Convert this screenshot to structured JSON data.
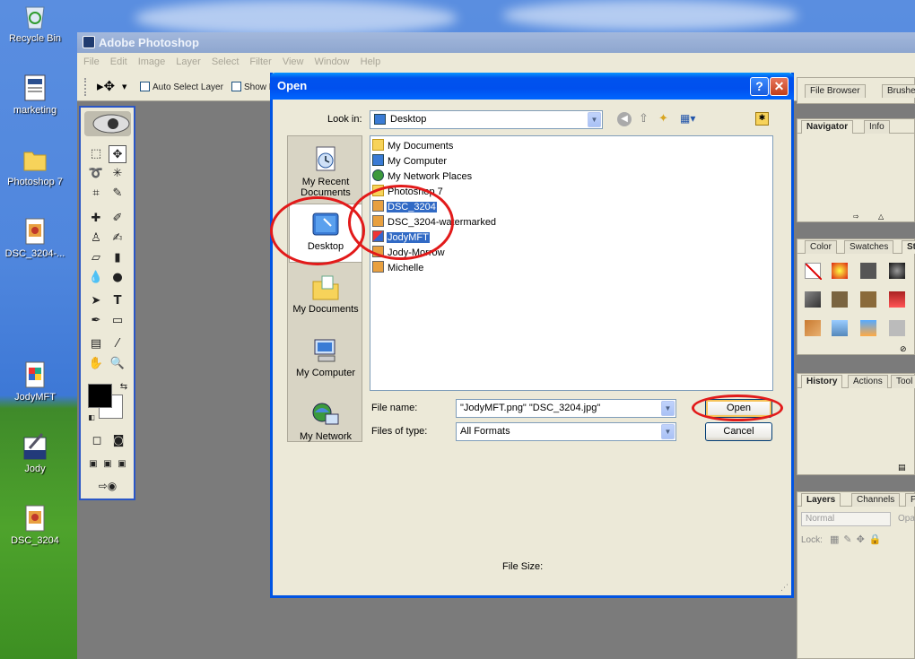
{
  "desktop": {
    "icons": [
      {
        "label": "Recycle Bin",
        "icon": "recycle-bin-icon"
      },
      {
        "label": "marketing",
        "icon": "document-icon"
      },
      {
        "label": "Photoshop 7",
        "icon": "folder-icon"
      },
      {
        "label": "DSC_3204-...",
        "icon": "image-file-icon"
      },
      {
        "label": "JodyMFT",
        "icon": "png-file-icon"
      },
      {
        "label": "Jody",
        "icon": "brushes-icon"
      },
      {
        "label": "DSC_3204",
        "icon": "image-file-icon"
      }
    ]
  },
  "photoshop": {
    "title": "Adobe Photoshop",
    "menu": [
      "File",
      "Edit",
      "Image",
      "Layer",
      "Select",
      "Filter",
      "View",
      "Window",
      "Help"
    ],
    "options": {
      "auto_select_label": "Auto Select Layer",
      "show_label": "Show B"
    },
    "palettes": {
      "top_tabs": [
        "File Browser",
        "Brushes"
      ],
      "navigator_tabs": [
        "Navigator",
        "Info"
      ],
      "color_tabs": [
        "Color",
        "Swatches",
        "Styles"
      ],
      "history_tabs": [
        "History",
        "Actions",
        "Tool"
      ],
      "layers_tabs": [
        "Layers",
        "Channels",
        "Paths"
      ],
      "blend_mode": "Normal",
      "opacity_label": "Opa",
      "lock_label": "Lock:"
    }
  },
  "dialog": {
    "title": "Open",
    "look_in_label": "Look in:",
    "look_in_value": "Desktop",
    "places": [
      "My Recent Documents",
      "Desktop",
      "My Documents",
      "My Computer",
      "My Network"
    ],
    "files": [
      {
        "name": "My Documents",
        "icon": "my-documents-icon",
        "selected": false
      },
      {
        "name": "My Computer",
        "icon": "my-computer-icon",
        "selected": false
      },
      {
        "name": "My Network Places",
        "icon": "network-places-icon",
        "selected": false
      },
      {
        "name": "Photoshop 7",
        "icon": "folder-icon",
        "selected": false
      },
      {
        "name": "DSC_3204",
        "icon": "jpg-file-icon",
        "selected": true
      },
      {
        "name": "DSC_3204-watermarked",
        "icon": "jpg-file-icon",
        "selected": false
      },
      {
        "name": "JodyMFT",
        "icon": "png-file-icon",
        "selected": true
      },
      {
        "name": "Jody-Morrow",
        "icon": "jpg-file-icon",
        "selected": false
      },
      {
        "name": "Michelle",
        "icon": "jpg-file-icon",
        "selected": false
      }
    ],
    "file_name_label": "File name:",
    "file_name_value": "\"JodyMFT.png\" \"DSC_3204.jpg\"",
    "files_of_type_label": "Files of type:",
    "files_of_type_value": "All Formats",
    "open_button": "Open",
    "cancel_button": "Cancel",
    "file_size_label": "File Size:",
    "help_glyph": "?",
    "close_glyph": "✕"
  }
}
